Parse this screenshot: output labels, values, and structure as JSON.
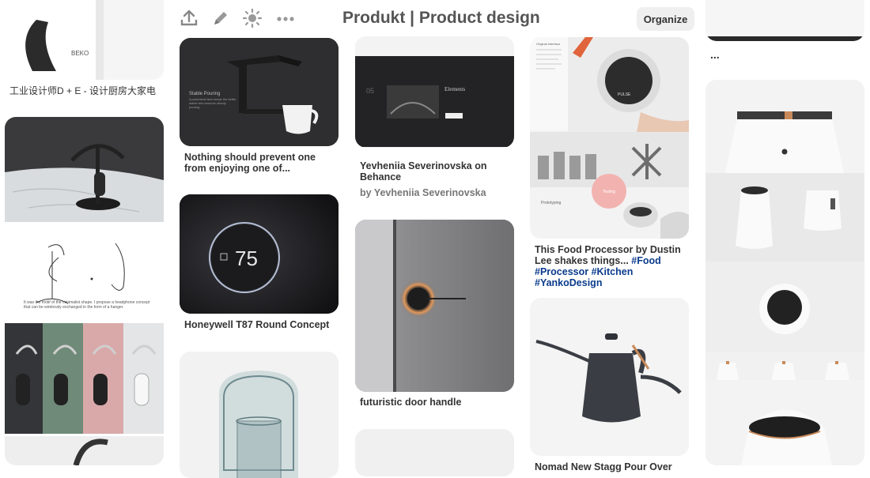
{
  "header": {
    "title": "Produkt | Product design",
    "organize_label": "Organize",
    "icons": [
      "upload-icon",
      "pencil-icon",
      "sun-icon",
      "more-dots-icon"
    ]
  },
  "pins": {
    "col1": {
      "caption1": "工业设计师D + E - 设计厨房大家电",
      "logo_text": "BEKO",
      "sketch_caption": "It was the motif of the minimalist shape. I propose a headphone concept that can be wirelessly exchanged in the form of a hanger."
    },
    "col2": {
      "pin1_title": "Nothing should prevent one from enjoying one of...",
      "pin1_overlay_title": "Stable Pouring",
      "pin1_overlay_body": "A peripheral face keeps the kettle stable and ensures steady pouring.",
      "pin2_title": "Honeywell T87 Round Concept",
      "pin2_display_value": "75"
    },
    "col3": {
      "pin1_title": "Yevheniia Severinovska on Behance",
      "pin1_by": "by Yevheniia Severinovska",
      "pin1_slide_num": "05",
      "pin1_slide_title": "Elements",
      "pin2_title": "futuristic door handle"
    },
    "col4": {
      "pin1_title_part1": "This Food Processor by Dustin Lee shakes things...",
      "pin1_tags": "#Food #Processor #Kitchen #YankoDesign",
      "brand": "PULSE",
      "badge": "Testing",
      "section1": "Original interface",
      "section2": "Prototyping",
      "pin2_title": "Nomad New Stagg Pour Over"
    },
    "col5": {
      "more_label": "..."
    }
  },
  "colors": {
    "title": "#555555",
    "caption": "#333333",
    "tag_link": "#0a3b8c",
    "copper_accent": "#c88a5a",
    "pink_accent": "#f2b3b0"
  }
}
